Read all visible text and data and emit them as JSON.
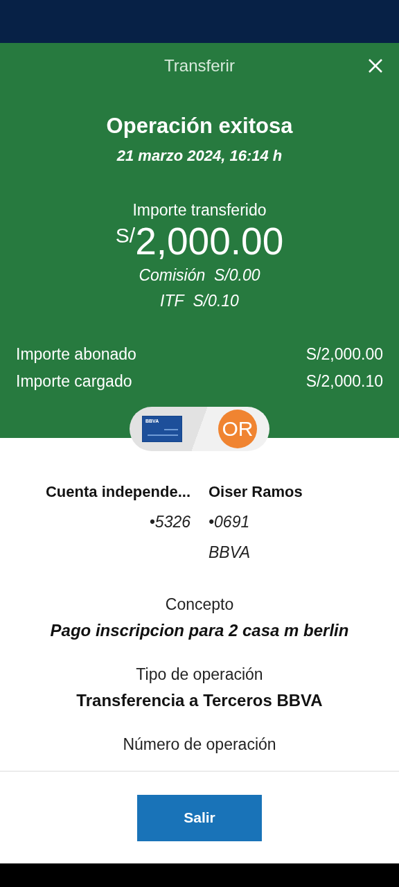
{
  "header": {
    "title": "Transferir"
  },
  "result": {
    "heading": "Operación exitosa",
    "date": "21 marzo 2024, 16:14 h"
  },
  "amount": {
    "label": "Importe transferido",
    "currency": "S/",
    "value": "2,000.00"
  },
  "fees": [
    {
      "label": "Comisión",
      "value": "S/0.00"
    },
    {
      "label": "ITF",
      "value": "S/0.10"
    }
  ],
  "totals": [
    {
      "label": "Importe abonado",
      "value": "S/2,000.00"
    },
    {
      "label": "Importe cargado",
      "value": "S/2,000.10"
    }
  ],
  "origin": {
    "card_brand": "BBVA",
    "name": "Cuenta independe...",
    "number": "•5326"
  },
  "destination": {
    "initials": "OR",
    "name": "Oiser Ramos",
    "number": "•0691",
    "bank": "BBVA"
  },
  "details": [
    {
      "label": "Concepto",
      "value": "Pago inscripcion para 2 casa m berlin",
      "kind": "italic"
    },
    {
      "label": "Tipo de operación",
      "value": "Transferencia a Terceros BBVA",
      "kind": "plain"
    },
    {
      "label": "Número de operación"
    }
  ],
  "footer": {
    "button": "Salir"
  }
}
